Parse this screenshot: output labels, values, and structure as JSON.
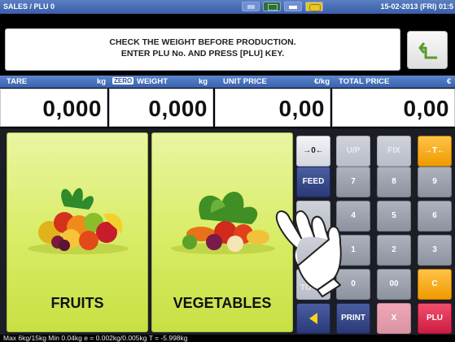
{
  "statusbar": {
    "title": "SALES / PLU 0",
    "datetime": "15-02-2013 (FRI) 01:5"
  },
  "message": {
    "line1": "CHECK THE WEIGHT BEFORE PRODUCTION.",
    "line2": "ENTER PLU No. AND PRESS [PLU] KEY."
  },
  "headers": {
    "tare": "TARE",
    "tare_unit": "kg",
    "zero_badge": "ZERO",
    "weight": "WEIGHT",
    "weight_unit": "kg",
    "unit_price": "UNIT PRICE",
    "unit_price_unit": "€/kg",
    "total_price": "TOTAL PRICE",
    "total_price_unit": "€"
  },
  "values": {
    "tare": "0,000",
    "weight": "0,000",
    "unit_price": "0,00",
    "total_price": "0,00"
  },
  "categories": [
    {
      "label": "FRUITS"
    },
    {
      "label": "VEGETABLES"
    }
  ],
  "keypad": {
    "zero_key": "→0←",
    "up_key": "U/P",
    "fix_key": "FIX",
    "tare_key": "→T←",
    "feed_key": "FEED",
    "k7": "7",
    "k8": "8",
    "k9": "9",
    "k4": "4",
    "k5": "5",
    "k6": "6",
    "k1": "1",
    "k2": "2",
    "k3": "3",
    "subtotal_key": "SUB TOTAL",
    "k0": "0",
    "k00": "00",
    "clear_key": "C",
    "print_key": "PRINT",
    "x_key": "X",
    "plu_key": "PLU"
  },
  "footer": {
    "info": "Max 6kg/15kg  Min 0.04kg  e = 0.002kg/0.005kg  T = -5.998kg"
  }
}
